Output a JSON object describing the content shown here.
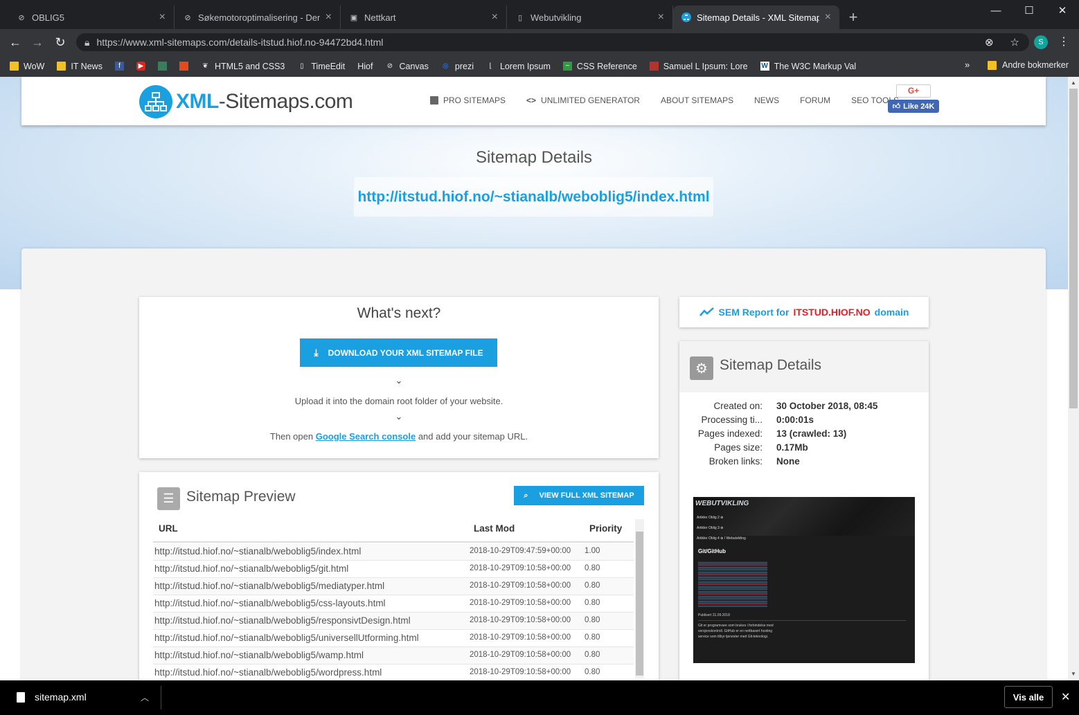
{
  "browser": {
    "tabs": [
      {
        "title": "OBLIG5",
        "icon": "gitlab-icon",
        "active": false
      },
      {
        "title": "Søkemotoroptimalisering - Denn",
        "icon": "gitlab-icon",
        "active": false
      },
      {
        "title": "Nettkart",
        "icon": "suitcase-icon",
        "active": false
      },
      {
        "title": "Webutvikling",
        "icon": "document-icon",
        "active": false
      },
      {
        "title": "Sitemap Details - XML Sitemaps",
        "icon": "sitemap-favicon",
        "active": true
      }
    ],
    "new_tab": "+",
    "window_controls": [
      "—",
      "☐",
      "✕"
    ],
    "url": "https://www.xml-sitemaps.com/details-itstud.hiof.no-94472bd4.html",
    "profile_initial": "S",
    "bookmarks": [
      "WoW",
      "IT News",
      "",
      "",
      "",
      "",
      "HTML5 and CSS3",
      "TimeEdit",
      "Hiof",
      "Canvas",
      "prezi",
      "Lorem Ipsum",
      "CSS Reference",
      "Samuel L Ipsum: Lore",
      "The W3C Markup Val"
    ],
    "bookmarks_overflow": "»",
    "other_bookmarks": "Andre bokmerker"
  },
  "site": {
    "logo_bold": "XML",
    "logo_rest": "-Sitemaps.com",
    "menu": [
      "PRO SITEMAPS",
      "UNLIMITED GENERATOR",
      "ABOUT SITEMAPS",
      "NEWS",
      "FORUM",
      "SEO TOOLS"
    ],
    "gplus": "G+",
    "fb_like": "Like 24K"
  },
  "hero": {
    "title": "Sitemap Details",
    "url": "http://itstud.hiof.no/~stianalb/weboblig5/index.html"
  },
  "next": {
    "title": "What's next?",
    "download_button": "DOWNLOAD YOUR XML SITEMAP FILE",
    "step1": "Upload it into the domain root folder of your website.",
    "step2_pre": "Then open ",
    "step2_link": "Google Search console",
    "step2_post": " and add your sitemap URL."
  },
  "preview": {
    "title": "Sitemap Preview",
    "view_button": "VIEW FULL XML SITEMAP",
    "columns": [
      "URL",
      "Last Mod",
      "Priority"
    ],
    "rows": [
      {
        "url": "http://itstud.hiof.no/~stianalb/weboblig5/index.html",
        "lastmod": "2018-10-29T09:47:59+00:00",
        "priority": "1.00"
      },
      {
        "url": "http://itstud.hiof.no/~stianalb/weboblig5/git.html",
        "lastmod": "2018-10-29T09:10:58+00:00",
        "priority": "0.80"
      },
      {
        "url": "http://itstud.hiof.no/~stianalb/weboblig5/mediatyper.html",
        "lastmod": "2018-10-29T09:10:58+00:00",
        "priority": "0.80"
      },
      {
        "url": "http://itstud.hiof.no/~stianalb/weboblig5/css-layouts.html",
        "lastmod": "2018-10-29T09:10:58+00:00",
        "priority": "0.80"
      },
      {
        "url": "http://itstud.hiof.no/~stianalb/weboblig5/responsivtDesign.html",
        "lastmod": "2018-10-29T09:10:58+00:00",
        "priority": "0.80"
      },
      {
        "url": "http://itstud.hiof.no/~stianalb/weboblig5/universellUtforming.html",
        "lastmod": "2018-10-29T09:10:58+00:00",
        "priority": "0.80"
      },
      {
        "url": "http://itstud.hiof.no/~stianalb/weboblig5/wamp.html",
        "lastmod": "2018-10-29T09:10:58+00:00",
        "priority": "0.80"
      },
      {
        "url": "http://itstud.hiof.no/~stianalb/weboblig5/wordpress.html",
        "lastmod": "2018-10-29T09:10:58+00:00",
        "priority": "0.80"
      }
    ]
  },
  "sem": {
    "prefix": "SEM Report for ",
    "domain": "ITSTUD.HIOF.NO",
    "suffix": " domain"
  },
  "details": {
    "title": "Sitemap Details",
    "rows": [
      {
        "key": "Created on:",
        "value": "30 October 2018, 08:45"
      },
      {
        "key": "Processing ti...",
        "value": "0:00:01s"
      },
      {
        "key": "Pages indexed:",
        "value": "13 (crawled: 13)"
      },
      {
        "key": "Pages size:",
        "value": "0.17Mb"
      },
      {
        "key": "Broken links:",
        "value": "None"
      }
    ],
    "thumbnail": {
      "site_title": "WEBUTVIKLING",
      "menu": [
        "Artikler Oblig 2 ⊕",
        "Artikler Oblig 3 ⊕",
        "Artikler Oblig 4 ⊕ / Webutvikling"
      ],
      "heading": "Git/GitHub",
      "date": "Publisert 31.09.2018",
      "text": "Git er programvare som brukes i forbindelse med versjonskontroll. GitHub er en nettbasert hosting service som tilbyr tjenester med Git-teknologi."
    }
  },
  "downloads": {
    "file": "sitemap.xml",
    "show_all": "Vis alle"
  },
  "colors": {
    "accent": "#1a9fe0",
    "domain_red": "#e21f26"
  }
}
